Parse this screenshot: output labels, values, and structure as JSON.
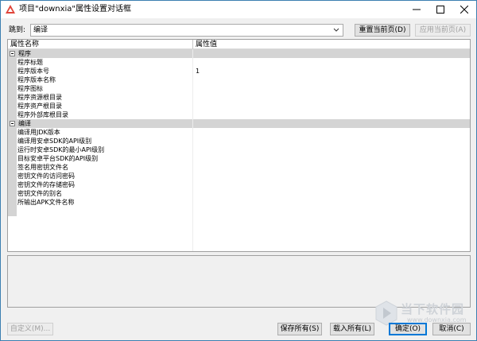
{
  "window": {
    "title": "项目\"downxia\"属性设置对话框"
  },
  "toolbar": {
    "jump_label": "跳到:",
    "jump_value": "编译",
    "reset_button": "重置当前页(D)",
    "apply_button": "应用当前页(A)"
  },
  "grid": {
    "col_name": "属性名称",
    "col_value": "属性值",
    "categories": [
      {
        "label": "程序",
        "props": [
          {
            "name": "程序标题",
            "value": ""
          },
          {
            "name": "程序版本号",
            "value": "1"
          },
          {
            "name": "程序版本名称",
            "value": ""
          },
          {
            "name": "程序图标",
            "value": ""
          },
          {
            "name": "程序资源根目录",
            "value": ""
          },
          {
            "name": "程序资产根目录",
            "value": ""
          },
          {
            "name": "程序外部库根目录",
            "value": ""
          }
        ]
      },
      {
        "label": "编译",
        "props": [
          {
            "name": "编译用JDK版本",
            "value": ""
          },
          {
            "name": "编译用安卓SDK的API级别",
            "value": ""
          },
          {
            "name": "运行时安卓SDK的最小API级别",
            "value": ""
          },
          {
            "name": "目标安卓平台SDK的API级别",
            "value": ""
          },
          {
            "name": "签名用密钥文件名",
            "value": ""
          },
          {
            "name": "密钥文件的访问密码",
            "value": ""
          },
          {
            "name": "密钥文件的存储密码",
            "value": ""
          },
          {
            "name": "密钥文件的别名",
            "value": ""
          },
          {
            "name": "所输出APK文件名称",
            "value": ""
          }
        ]
      }
    ]
  },
  "footer": {
    "custom_button": "自定义(M)...",
    "save_all_button": "保存所有(S)",
    "load_all_button": "载入所有(L)",
    "ok_button": "确定(O)",
    "cancel_button": "取消(C)"
  },
  "watermark": {
    "text": "当下软件园",
    "url": "www.downxia.com"
  },
  "colors": {
    "accent": "#0078d7",
    "category_bg": "#d4d4d4",
    "icon_red": "#e0453a"
  }
}
